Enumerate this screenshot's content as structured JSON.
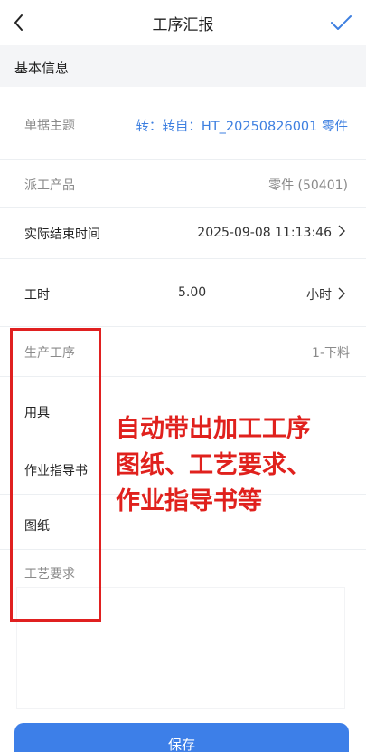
{
  "header": {
    "title": "工序汇报",
    "back_icon": "chevron-left-icon",
    "confirm_icon": "checkmark-icon",
    "accent_color": "#3d7fe0"
  },
  "section": {
    "title": "基本信息"
  },
  "fields": {
    "doc_subject": {
      "label": "单据主题",
      "value": "转：转自：HT_20250826001 零件"
    },
    "dispatch_product": {
      "label": "派工产品",
      "value": "零件 (50401)"
    },
    "actual_end_time": {
      "label": "实际结束时间",
      "value": "2025-09-08 11:13:46"
    },
    "work_hours": {
      "label": "工时",
      "value": "5.00",
      "unit": "小时"
    },
    "process": {
      "label": "生产工序",
      "value": "1-下料"
    },
    "tools": {
      "label": "用具"
    },
    "work_instruction": {
      "label": "作业指导书"
    },
    "drawing": {
      "label": "图纸"
    },
    "process_requirements": {
      "label": "工艺要求"
    }
  },
  "annotation": {
    "lines": [
      "自动带出加工工序",
      "图纸、工艺要求、",
      "作业指导书等"
    ],
    "color": "#e02020"
  },
  "footer": {
    "save_label": "保存"
  }
}
